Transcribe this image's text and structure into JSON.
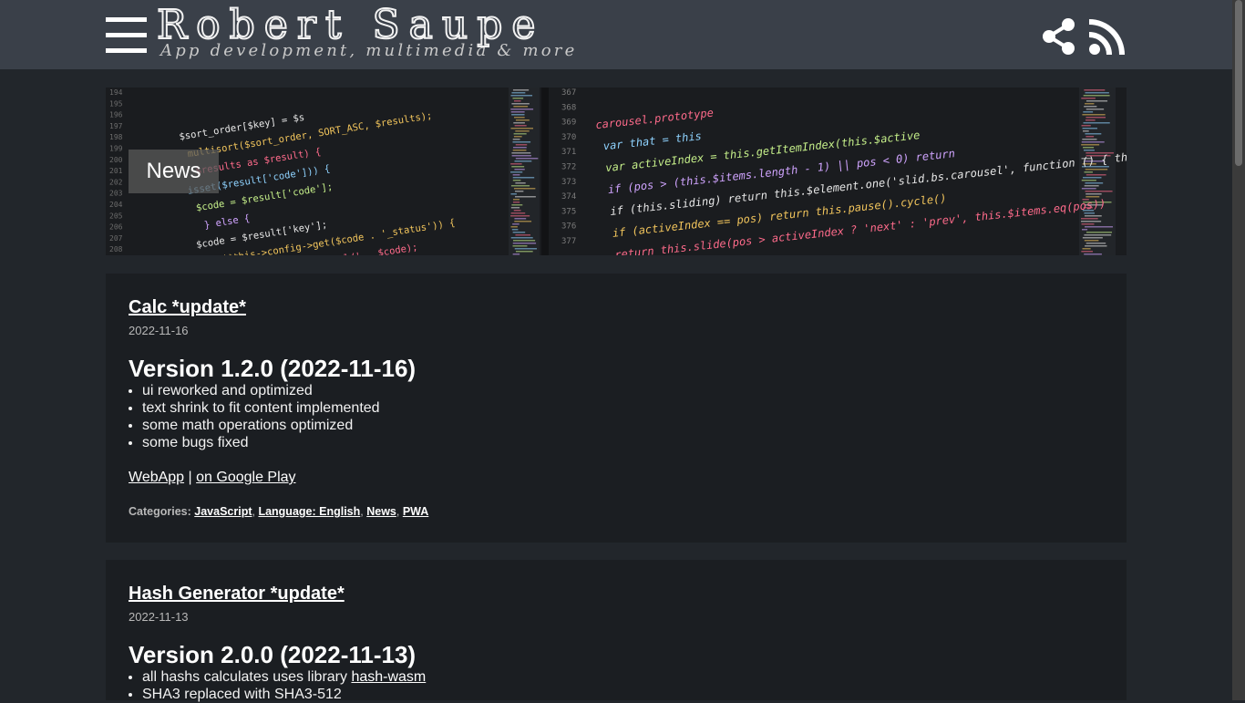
{
  "header": {
    "title": "Robert Saupe",
    "subtitle": "App development, multimedia & more",
    "menu_icon": "menu-icon",
    "share_icon": "share-icon",
    "rss_icon": "rss-icon"
  },
  "banner": {
    "label": "News",
    "code_left": [
      "$sort_order[$key] = $s",
      "multisort($sort_order, SORT_ASC, $results);",
      "$results as $result) {",
      "isset($result['code'])) {",
      "$code = $result['code'];",
      "} else {",
      "$code = $result['key'];",
      "if ($this->config->get($code . '_status')) {",
      "->model('extension/total/' . $code);"
    ],
    "code_right": [
      "carousel.prototype",
      "var that = this",
      "var activeIndex = this.getItemIndex(this.$active",
      "if (pos > (this.$items.length - 1) || pos < 0) return",
      "if (this.sliding)  return this.$element.one('slid.bs.carousel', function () { that.to(pos) })",
      "if (activeIndex == pos) return this.pause().cycle()",
      "return this.slide(pos > activeIndex ? 'next' : 'prev', this.$items.eq(pos))"
    ],
    "line_numbers_left": [
      "194",
      "195",
      "196",
      "197",
      "198",
      "199",
      "200",
      "201",
      "202",
      "203",
      "204",
      "205",
      "206",
      "207",
      "208"
    ],
    "line_numbers_right": [
      "367",
      "368",
      "369",
      "370",
      "371",
      "372",
      "373",
      "374",
      "375",
      "376",
      "377"
    ]
  },
  "posts": [
    {
      "title": "Calc *update*",
      "date": "2022-11-16",
      "version": "Version 1.2.0 (2022-11-16)",
      "changes": [
        "ui reworked and optimized",
        "text shrink to fit content implemented",
        "some math operations optimized",
        "some bugs fixed"
      ],
      "link_webapp": "WebApp",
      "link_sep": " | ",
      "link_play": "on Google Play",
      "categories_label": "Categories:",
      "categories": [
        "JavaScript",
        "Language: English",
        "News",
        "PWA"
      ]
    },
    {
      "title": "Hash Generator *update*",
      "date": "2022-11-13",
      "version": "Version 2.0.0 (2022-11-13)",
      "change1_text": "all hashs calculates uses library ",
      "change1_link": "hash-wasm",
      "change2_text": "SHA3 replaced with SHA3-512"
    }
  ]
}
